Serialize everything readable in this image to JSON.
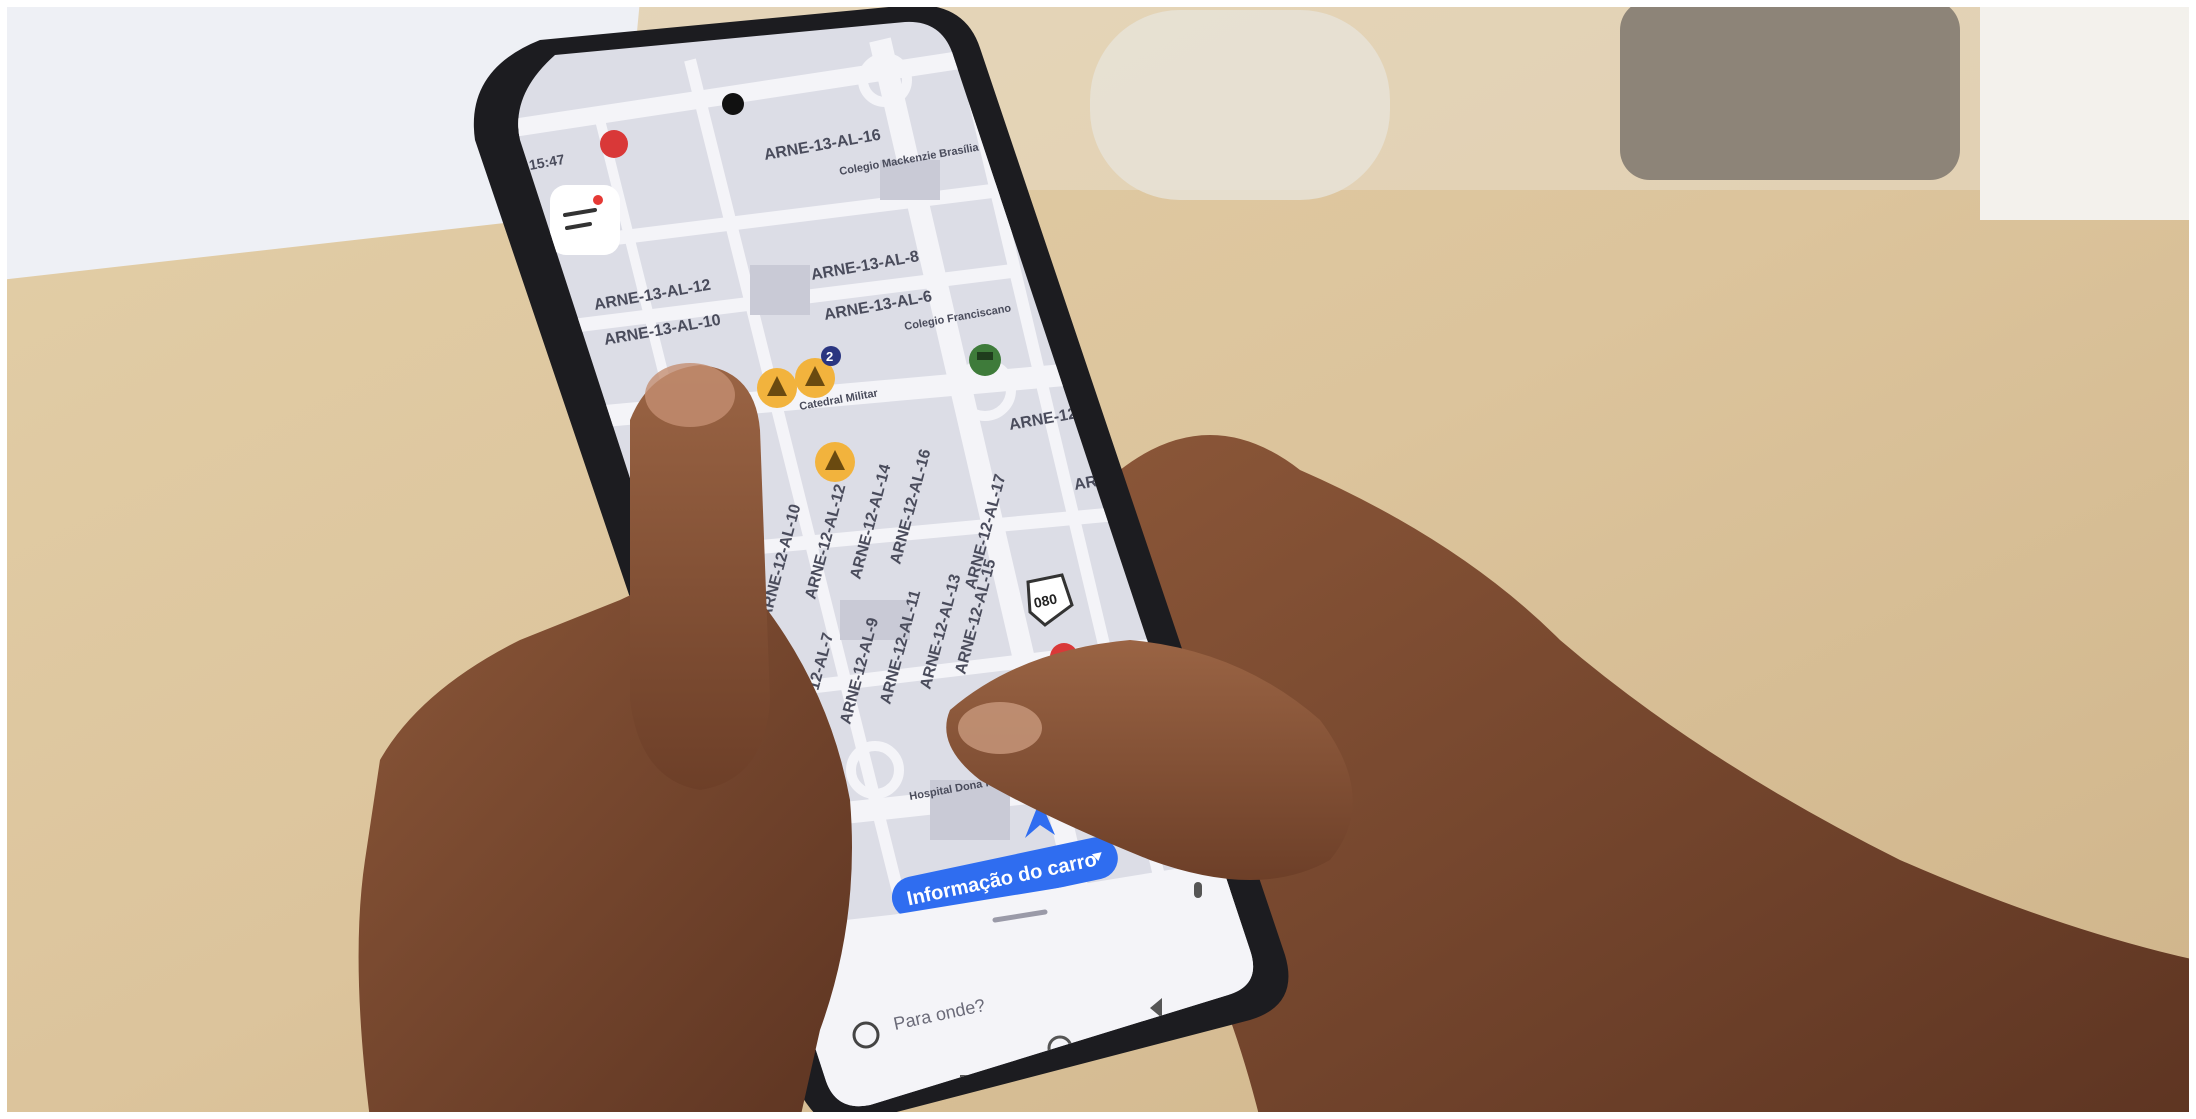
{
  "status_bar": {
    "time": "15:47"
  },
  "map": {
    "labels": [
      "ARNE-13-AL-16",
      "Colegio Mackenzie Brasília",
      "ARNE-13-AL-12",
      "ARNE-13-AL-8",
      "ARNE-13-AL-10",
      "ARNE-13-AL-6",
      "Colegio Franciscano",
      "ARNE-12-AL",
      "Catedral Militar",
      "ARNE",
      "ARNE-12-AL-10",
      "ARNE-12-AL-12",
      "ARNE-12-AL-14",
      "ARNE-12-AL-16",
      "ARNE-12-AL-17",
      "ARNE-12-AL-7",
      "ARNE-12-AL-9",
      "ARNE-12-AL-11",
      "ARNE-12-AL-13",
      "ARNE-12-AL-15",
      "Hospital Dona Regina"
    ],
    "highway_shield": "080",
    "report_count_badge": "2"
  },
  "car_info_pill": {
    "label": "Informação do carro"
  },
  "search": {
    "placeholder": "Para onde?"
  },
  "colors": {
    "map_background": "#dcdde6",
    "road": "#f4f4f8",
    "accent_blue": "#2f6df0",
    "marker_yellow": "#f2b33d",
    "table_wood": "#dcc49c"
  }
}
